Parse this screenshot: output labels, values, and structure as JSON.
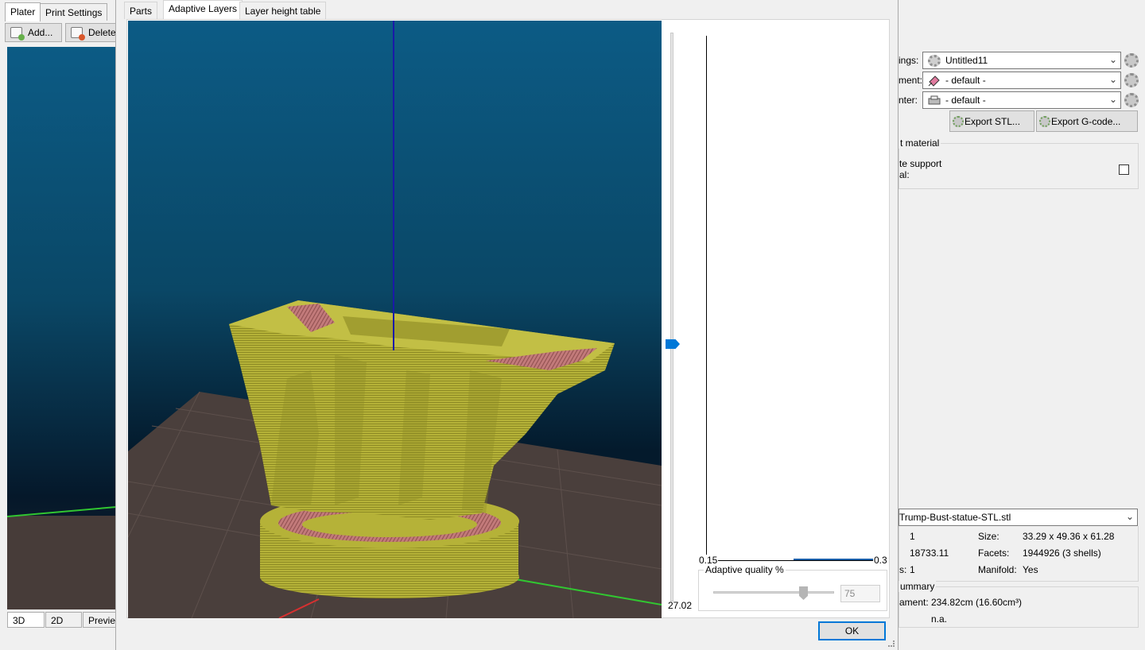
{
  "main": {
    "tabs": [
      "Plater",
      "Print Settings"
    ],
    "toolbar": {
      "add_label": "Add...",
      "delete_label": "Delete"
    },
    "view_tabs": [
      "3D",
      "2D",
      "Preview"
    ]
  },
  "right_panel": {
    "settings_label": "ings:",
    "settings_value": "Untitled11",
    "filament_label": "ment:",
    "filament_value": "- default -",
    "printer_label": "nter:",
    "printer_value": "- default -",
    "export_stl_label": "Export STL...",
    "export_gcode_label": "Export G-code...",
    "support_group_title": "t material",
    "support_label_line1": "te support",
    "support_label_line2": "al:",
    "object_combo_value": "Trump-Bust-statue-STL.stl",
    "info": {
      "copies_value": "1",
      "size_label": "Size:",
      "size_value": "33.29 x 49.36 x 61.28",
      "volume_value": "18733.11",
      "facets_label": "Facets:",
      "facets_value": "1944926 (3 shells)",
      "parts_label": "s:",
      "parts_value": "1",
      "manifold_label": "Manifold:",
      "manifold_value": "Yes"
    },
    "summary_title": "ummary",
    "filament_usage_label": "ament:",
    "filament_usage_value": "234.82cm (16.60cm³)",
    "cost_value": "n.a."
  },
  "dialog": {
    "tabs": [
      "Parts",
      "Adaptive Layers",
      "Layer height table"
    ],
    "active_tab": "Adaptive Layers",
    "layer_slider_value": "27.02",
    "graph_x_min": "0.15",
    "graph_x_max": "0.3",
    "adaptive_quality_title": "Adaptive quality %",
    "adaptive_quality_value": "75",
    "ok_label": "OK"
  },
  "colors": {
    "accent": "#0078d7",
    "sky_top": "#0c5b85",
    "model_yellow": "#b5b238",
    "infill_pink": "#c27a7a",
    "floor": "#4a3f3c"
  }
}
